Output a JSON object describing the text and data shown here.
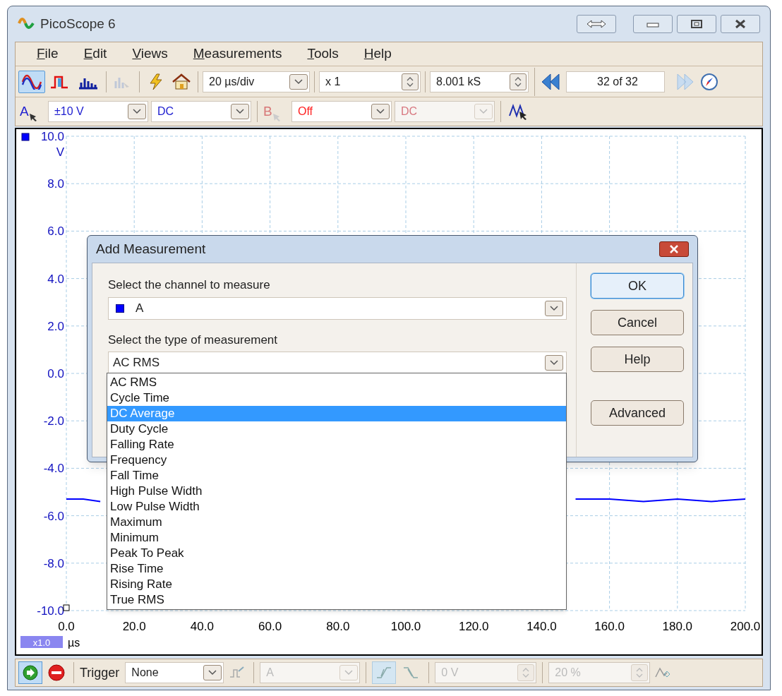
{
  "window": {
    "title": "PicoScope 6"
  },
  "menu": [
    {
      "label": "File"
    },
    {
      "label": "Edit"
    },
    {
      "label": "Views"
    },
    {
      "label": "Measurements"
    },
    {
      "label": "Tools"
    },
    {
      "label": "Help"
    }
  ],
  "toolbar": {
    "view_modes": [
      {
        "kind": "scope",
        "selected": true
      },
      {
        "kind": "persistence",
        "selected": false
      },
      {
        "kind": "spectrum",
        "selected": false
      }
    ],
    "timebase": "20 µs/div",
    "zoom": "x 1",
    "samples": "8.001 kS",
    "buffer": "32 of 32"
  },
  "channels": [
    {
      "label": "A",
      "range": "±10 V",
      "coupling": "DC",
      "enabled": true
    },
    {
      "label": "B",
      "range": "Off",
      "coupling": "DC",
      "enabled": false
    }
  ],
  "scope": {
    "y_unit": "V",
    "x_unit": "µs",
    "zoom_badge": "x1.0",
    "chart_data": {
      "type": "line",
      "x": [
        0,
        5,
        10,
        80,
        150,
        160,
        170,
        180,
        190,
        200
      ],
      "grid": true,
      "series": [
        {
          "color": "#0000ff",
          "values": [
            -5.3,
            -5.3,
            -5.4,
            null,
            -5.3,
            -5.3,
            -5.4,
            -5.3,
            -5.4,
            -5.3
          ]
        }
      ],
      "xlim": [
        0,
        200
      ],
      "ylim": [
        -10,
        10
      ],
      "xticks": [
        {
          "value": 0,
          "label": "0.0"
        },
        {
          "value": 20,
          "label": "20.0"
        },
        {
          "value": 40,
          "label": "40.0"
        },
        {
          "value": 60,
          "label": "60.0"
        },
        {
          "value": 80,
          "label": "80.0"
        },
        {
          "value": 100,
          "label": "100.0"
        },
        {
          "value": 120,
          "label": "120.0"
        },
        {
          "value": 140,
          "label": "140.0"
        },
        {
          "value": 160,
          "label": "160.0"
        },
        {
          "value": 180,
          "label": "180.0"
        },
        {
          "value": 200,
          "label": "200.0"
        }
      ],
      "yticks": [
        {
          "value": 10,
          "label": "10.0"
        },
        {
          "value": 8,
          "label": "8.0"
        },
        {
          "value": 6,
          "label": "6.0"
        },
        {
          "value": 4,
          "label": "4.0"
        },
        {
          "value": 2,
          "label": "2.0"
        },
        {
          "value": 0,
          "label": "0.0"
        },
        {
          "value": -2,
          "label": "-2.0"
        },
        {
          "value": -4,
          "label": "-4.0"
        },
        {
          "value": -6,
          "label": "-6.0"
        },
        {
          "value": -8,
          "label": "-8.0"
        },
        {
          "value": -10,
          "label": "-10.0"
        }
      ]
    }
  },
  "dialog": {
    "title": "Add Measurement",
    "channel_label": "Select the channel to measure",
    "channel_value": "A",
    "type_label": "Select the type of measurement",
    "type_value": "AC RMS",
    "options": [
      {
        "label": "AC RMS",
        "selected": false
      },
      {
        "label": "Cycle Time",
        "selected": false
      },
      {
        "label": "DC Average",
        "selected": true
      },
      {
        "label": "Duty Cycle",
        "selected": false
      },
      {
        "label": "Falling Rate",
        "selected": false
      },
      {
        "label": "Frequency",
        "selected": false
      },
      {
        "label": "Fall Time",
        "selected": false
      },
      {
        "label": "High Pulse Width",
        "selected": false
      },
      {
        "label": "Low Pulse Width",
        "selected": false
      },
      {
        "label": "Maximum",
        "selected": false
      },
      {
        "label": "Minimum",
        "selected": false
      },
      {
        "label": "Peak To Peak",
        "selected": false
      },
      {
        "label": "Rise Time",
        "selected": false
      },
      {
        "label": "Rising Rate",
        "selected": false
      },
      {
        "label": "True RMS",
        "selected": false
      }
    ],
    "buttons": [
      {
        "label": "OK",
        "kind": "default"
      },
      {
        "label": "Cancel",
        "kind": "normal"
      },
      {
        "label": "Help",
        "kind": "normal"
      },
      {
        "label": "Advanced",
        "kind": "spaced"
      }
    ]
  },
  "trigger": {
    "label": "Trigger",
    "mode": "None",
    "source": "A",
    "threshold": "0 V",
    "pre_trigger": "20 %",
    "edges": [
      {
        "kind": "rising",
        "selected": true
      },
      {
        "kind": "falling",
        "selected": false
      }
    ]
  }
}
